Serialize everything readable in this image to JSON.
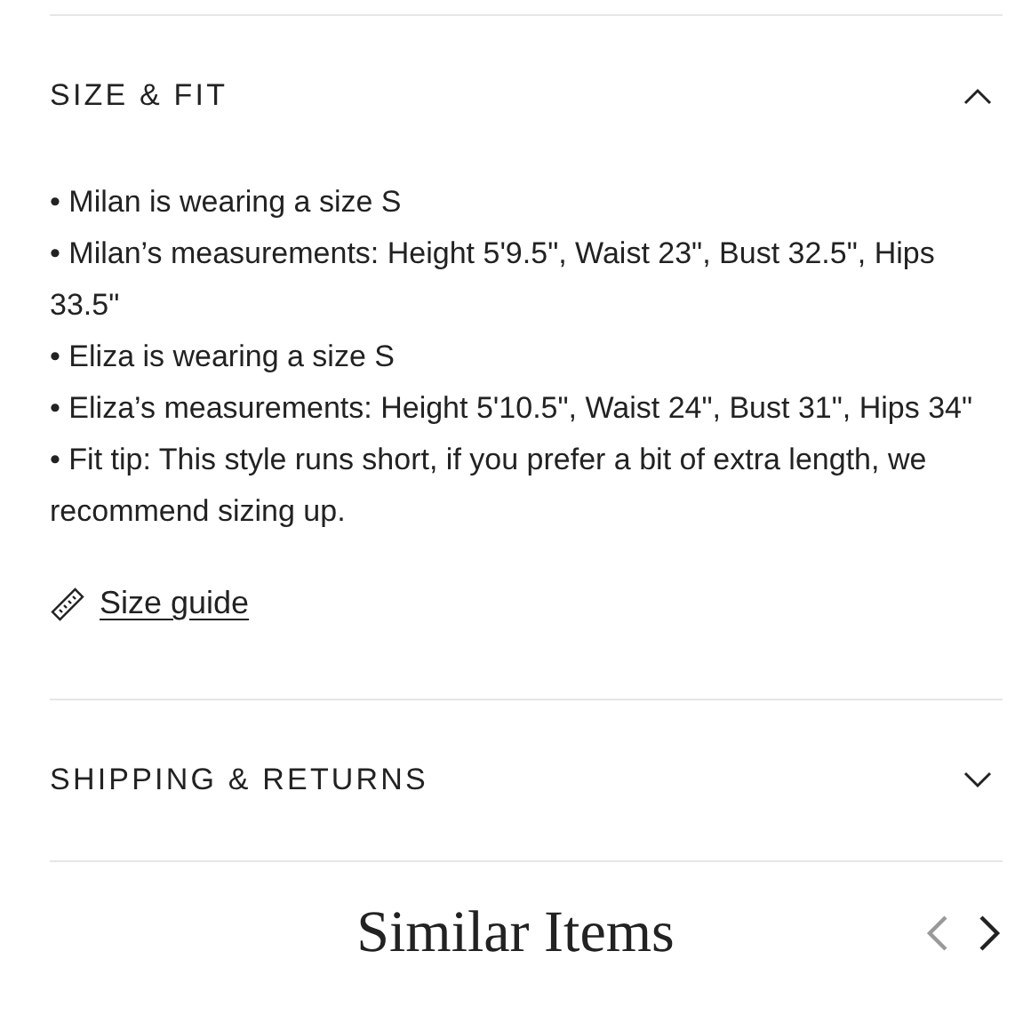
{
  "sections": [
    {
      "title": "SIZE & FIT",
      "expanded": true,
      "bullets": [
        "• Milan is wearing a size S",
        "• Milan’s measurements: Height 5'9.5\", Waist 23\", Bust 32.5\", Hips 33.5\"",
        "• Eliza is wearing a size S",
        "• Eliza’s measurements: Height 5'10.5\", Waist 24\", Bust 31\", Hips 34\"",
        "• Fit tip: This style runs short, if you prefer a bit of extra length, we recommend sizing up."
      ],
      "link": "Size guide"
    },
    {
      "title": "SHIPPING & RETURNS",
      "expanded": false
    }
  ],
  "similar": {
    "title": "Similar Items",
    "prev_disabled": true,
    "next_disabled": false
  }
}
